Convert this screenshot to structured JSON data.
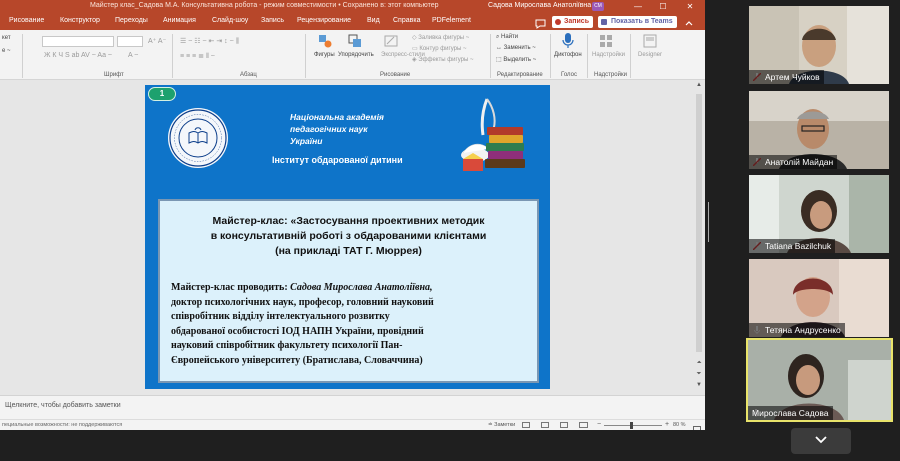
{
  "window": {
    "title": "Майстер клас_Садова М.А. Консультативна робота  -  режим совместимости  •  Сохранено в: этот компьютер",
    "user": "Садова Мирослава Анатоліївна",
    "user_initials": "СМ",
    "min_glyph": "—",
    "max_glyph": "☐",
    "close_glyph": "✕"
  },
  "tabs": [
    "Рисование",
    "Конструктор",
    "Переходы",
    "Анимация",
    "Слайд-шоу",
    "Запись",
    "Рецензирование",
    "Вид",
    "Справка",
    "PDFelement"
  ],
  "tabs_extra": {
    "search_icon": "search-icon",
    "record_label": "Запись",
    "teams_label": "Показать в Teams"
  },
  "ribbon": {
    "left_stub": [
      "кет",
      "е ~",
      ""
    ],
    "group_labels": [
      "Шрифт",
      "Абзац",
      "Рисование",
      "Редактирование",
      "Голос",
      "Надстройки"
    ],
    "drawing_buttons": [
      "Фигуры",
      "Упорядочить",
      "Экспресс-стили"
    ],
    "drawing_options": [
      "Заливка фигуры",
      "Контур фигуры",
      "Эффекты фигуры"
    ],
    "editing": [
      "Найти",
      "Заменить",
      "Выделить"
    ],
    "voice": "Диктофон",
    "addins": "Надстройки",
    "designer": "Designer"
  },
  "slide": {
    "number": "1",
    "academy_lines": [
      "Національна академія",
      "педагогічних наук",
      "України"
    ],
    "institute": "Інститут обдарованої дитини",
    "title_lines": [
      "Майстер-клас: «Застосування проективних методик",
      "в консультативній роботі з обдарованими клієнтами",
      "(на прикладі ТАТ  Г. Мюррея)"
    ],
    "body_intro": "Майстер-клас проводить: ",
    "body_name": "Садова Мирослава Анатоліївна,",
    "body_lines": [
      "доктор психологічних наук, професор, головний науковий",
      "співробітник відділу інтелектуального розвитку",
      "обдарованої особистості ІОД НАПН України, провідний",
      "науковий співробітник факультету психології Пан-",
      "Європейського університету (Братислава, Словаччина)"
    ]
  },
  "notes_placeholder": "Щелкните, чтобы добавить заметки",
  "status": {
    "accessibility": "пециальные возможности: не поддерживаются",
    "notes_button": "Заметки",
    "zoom": "80 %"
  },
  "participants": [
    {
      "name": "Артем Чуйков",
      "muted": true,
      "active": false
    },
    {
      "name": "Анатолій Майдан",
      "muted": true,
      "active": false
    },
    {
      "name": "Tatiana Bazilchuk",
      "muted": true,
      "active": false
    },
    {
      "name": "Тетяна Андрусенко",
      "muted": false,
      "active": false
    },
    {
      "name": "Мирослава Садова",
      "muted": false,
      "active": true
    }
  ],
  "colors": {
    "ppt_accent": "#b7472a",
    "slide_bg": "#0e74c9",
    "textbox_bg": "#dcf1fb",
    "active_speaker_border": "#e8e36a",
    "muted_mic": "#e04040"
  }
}
